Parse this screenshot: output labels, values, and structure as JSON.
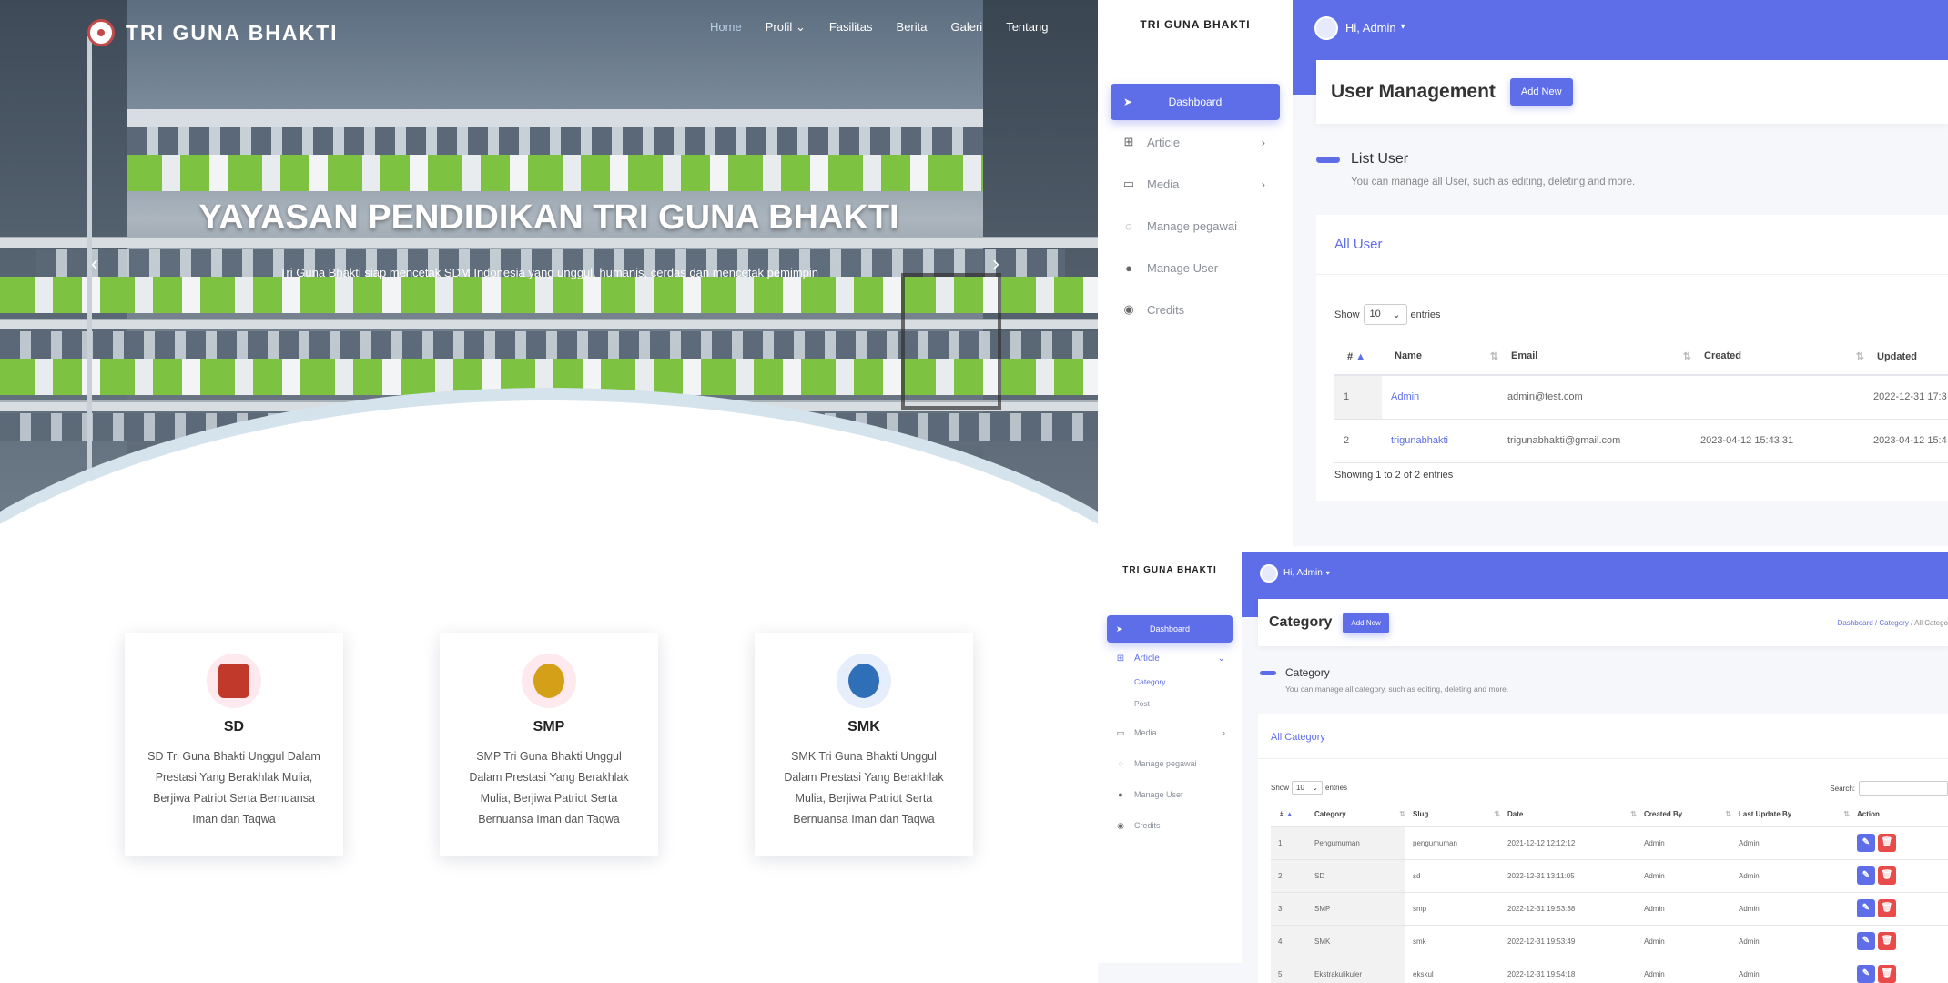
{
  "landing": {
    "brand": "TRI GUNA BHAKTI",
    "nav": [
      "Home",
      "Profil",
      "Fasilitas",
      "Berita",
      "Galeri",
      "Tentang"
    ],
    "nav_active": "Home",
    "hero_title": "YAYASAN PENDIDIKAN TRI GUNA BHAKTI",
    "hero_subtitle": "Tri Guna Bhakti siap mencetak SDM Indonesia yang unggul, humanis, cerdas dan mencetak pemimpin",
    "cards": [
      {
        "title": "SD",
        "text": "SD Tri Guna Bhakti Unggul Dalam Prestasi Yang Berakhlak Mulia, Berjiwa Patriot Serta Bernuansa Iman dan Taqwa",
        "emblem_color": "#c0392b"
      },
      {
        "title": "SMP",
        "text": "SMP Tri Guna Bhakti Unggul Dalam Prestasi Yang Berakhlak Mulia, Berjiwa Patriot Serta Bernuansa Iman dan Taqwa",
        "emblem_color": "#d4a017"
      },
      {
        "title": "SMK",
        "text": "SMK Tri Guna Bhakti Unggul Dalam Prestasi Yang Berakhlak Mulia, Berjiwa Patriot Serta Bernuansa Iman dan Taqwa",
        "emblem_color": "#2e6fb7"
      }
    ]
  },
  "user_admin": {
    "brand": "TRI GUNA BHAKTI",
    "greeting": "Hi, Admin",
    "menu": [
      "Dashboard",
      "Article",
      "Media",
      "Manage pegawai",
      "Manage User",
      "Credits"
    ],
    "page_title": "User Management",
    "add_new": "Add New",
    "section_title": "List User",
    "section_desc": "You can manage all User, such as editing, deleting and more.",
    "card_title": "All User",
    "show_label": "Show",
    "entries_value": "10",
    "entries_label": "entries",
    "columns": [
      "#",
      "Name",
      "Email",
      "Created",
      "Updated"
    ],
    "rows": [
      {
        "no": "1",
        "name": "Admin",
        "email": "admin@test.com",
        "created": "",
        "updated": "2022-12-31 17:3"
      },
      {
        "no": "2",
        "name": "trigunabhakti",
        "email": "trigunabhakti@gmail.com",
        "created": "2023-04-12 15:43:31",
        "updated": "2023-04-12 15:4"
      }
    ],
    "footer": "Showing 1 to 2 of 2 entries"
  },
  "category_admin": {
    "brand": "TRI GUNA BHAKTI",
    "greeting": "Hi, Admin",
    "menu": [
      "Dashboard",
      "Article",
      "Category",
      "Post",
      "Media",
      "Manage pegawai",
      "Manage User",
      "Credits"
    ],
    "page_title": "Category",
    "add_new": "Add New",
    "breadcrumb": [
      "Dashboard",
      "Category",
      "All Catego"
    ],
    "section_title": "Category",
    "section_desc": "You can manage all category, such as editing, deleting and more.",
    "card_title": "All Category",
    "show_label": "Show",
    "entries_value": "10",
    "entries_label": "entries",
    "search_label": "Search:",
    "columns": [
      "#",
      "Category",
      "Slug",
      "Date",
      "Created By",
      "Last Update By",
      "Action"
    ],
    "rows": [
      {
        "no": "1",
        "category": "Pengumuman",
        "slug": "pengumuman",
        "date": "2021-12-12 12:12:12",
        "created_by": "Admin",
        "updated_by": "Admin"
      },
      {
        "no": "2",
        "category": "SD",
        "slug": "sd",
        "date": "2022-12-31 13:11:05",
        "created_by": "Admin",
        "updated_by": "Admin"
      },
      {
        "no": "3",
        "category": "SMP",
        "slug": "smp",
        "date": "2022-12-31 19:53:38",
        "created_by": "Admin",
        "updated_by": "Admin"
      },
      {
        "no": "4",
        "category": "SMK",
        "slug": "smk",
        "date": "2022-12-31 19:53:49",
        "created_by": "Admin",
        "updated_by": "Admin"
      },
      {
        "no": "5",
        "category": "Ekstrakulikuler",
        "slug": "ekskul",
        "date": "2022-12-31 19:54:18",
        "created_by": "Admin",
        "updated_by": "Admin"
      }
    ]
  },
  "colors": {
    "accent": "#5e6ee8",
    "danger": "#e94b4b",
    "green": "#7ec242"
  }
}
